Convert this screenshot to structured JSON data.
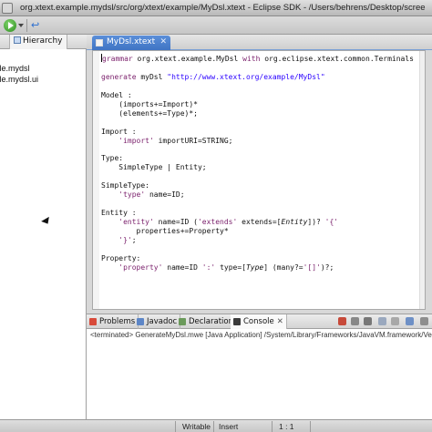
{
  "window": {
    "title": "org.xtext.example.mydsl/src/org/xtext/example/MyDsl.xtext - Eclipse SDK - /Users/behrens/Desktop/scree"
  },
  "left_panel": {
    "tab_label": "Hierarchy",
    "tree_items": [
      "ample.mydsl",
      "ample.mydsl.ui"
    ]
  },
  "editor": {
    "tab_label": "MyDsl.xtext",
    "tab_close": "✕",
    "code": [
      [
        [
          "kw",
          "grammar"
        ],
        [
          "",
          " org.xtext.example.MyDsl "
        ],
        [
          "kw",
          "with"
        ],
        [
          "",
          " org.eclipse.xtext.common.Terminals"
        ]
      ],
      [
        [
          "",
          ""
        ]
      ],
      [
        [
          "kw",
          "generate"
        ],
        [
          "",
          " myDsl "
        ],
        [
          "str",
          "\"http://www.xtext.org/example/MyDsl\""
        ]
      ],
      [
        [
          "",
          ""
        ]
      ],
      [
        [
          "",
          "Model :"
        ]
      ],
      [
        [
          "",
          "    (imports+=Import)*"
        ]
      ],
      [
        [
          "",
          "    (elements+=Type)*;"
        ]
      ],
      [
        [
          "",
          ""
        ]
      ],
      [
        [
          "",
          "Import :"
        ]
      ],
      [
        [
          "",
          "    "
        ],
        [
          "kw",
          "'import'"
        ],
        [
          "",
          " importURI=STRING;"
        ]
      ],
      [
        [
          "",
          ""
        ]
      ],
      [
        [
          "",
          "Type:"
        ]
      ],
      [
        [
          "",
          "    SimpleType | Entity;"
        ]
      ],
      [
        [
          "",
          ""
        ]
      ],
      [
        [
          "",
          "SimpleType:"
        ]
      ],
      [
        [
          "",
          "    "
        ],
        [
          "kw",
          "'type'"
        ],
        [
          "",
          " name=ID;"
        ]
      ],
      [
        [
          "",
          ""
        ]
      ],
      [
        [
          "",
          "Entity :"
        ]
      ],
      [
        [
          "",
          "    "
        ],
        [
          "kw",
          "'entity'"
        ],
        [
          "",
          " name=ID ("
        ],
        [
          "kw",
          "'extends'"
        ],
        [
          "",
          " extends=["
        ],
        [
          "it",
          "Entity"
        ],
        [
          "",
          "])? "
        ],
        [
          "kw",
          "'{'"
        ]
      ],
      [
        [
          "",
          "        properties+=Property*"
        ]
      ],
      [
        [
          "",
          "    "
        ],
        [
          "kw",
          "'}'"
        ],
        [
          "",
          ";"
        ]
      ],
      [
        [
          "",
          ""
        ]
      ],
      [
        [
          "",
          "Property:"
        ]
      ],
      [
        [
          "",
          "    "
        ],
        [
          "kw",
          "'property'"
        ],
        [
          "",
          " name=ID "
        ],
        [
          "kw",
          "':'"
        ],
        [
          "",
          " type=["
        ],
        [
          "it",
          "Type"
        ],
        [
          "",
          "] (many?="
        ],
        [
          "kw",
          "'[]'"
        ],
        [
          "",
          ")?;"
        ]
      ]
    ]
  },
  "bottom_panel": {
    "tabs": [
      "Problems",
      "Javadoc",
      "Declaration",
      "Console"
    ],
    "console_close": "✕",
    "console_text": "<terminated> GenerateMyDsl.mwe [Java Application] /System/Library/Frameworks/JavaVM.framework/Ver"
  },
  "status_bar": {
    "writable": "Writable",
    "insert": "Insert",
    "position": "1 : 1"
  },
  "colors": {
    "keyword": "#7a1f6b",
    "string": "#2a00ff",
    "active_tab": "#4a80d0"
  }
}
